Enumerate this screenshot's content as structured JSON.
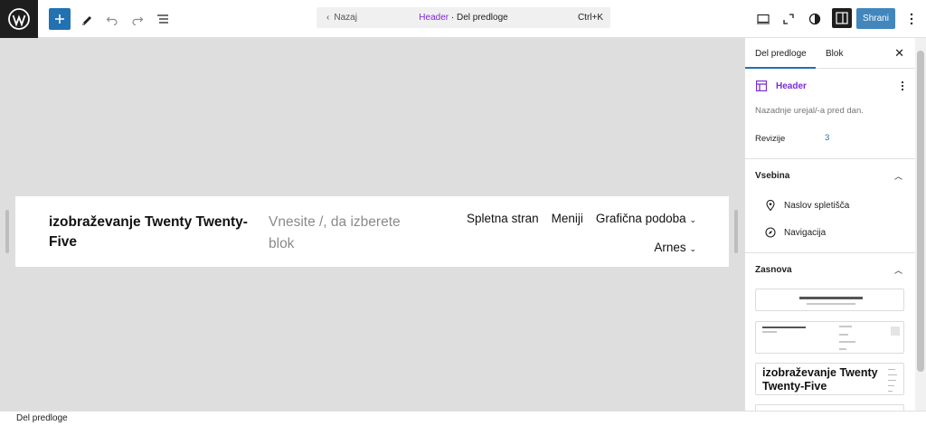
{
  "topbar": {
    "back_label": "Nazaj",
    "doc_title": "Header",
    "doc_type": " · Del predloge",
    "shortcut": "Ctrl+K",
    "save_label": "Shrani"
  },
  "canvas": {
    "site_title": "izobraževanje Twenty Twenty-Five",
    "block_placeholder": "Vnesite /, da izberete blok",
    "nav_row1": [
      "Spletna stran",
      "Meniji",
      "Grafična podoba"
    ],
    "nav_row2": [
      "Arnes"
    ]
  },
  "sidebar": {
    "tab_template_part": "Del predloge",
    "tab_block": "Blok",
    "part_name": "Header",
    "last_edited": "Nazadnje urejal/-a pred dan.",
    "revisions_label": "Revizije",
    "revisions_count": "3",
    "content_title": "Vsebina",
    "content_items": [
      "Naslov spletišča",
      "Navigacija"
    ],
    "layout_title": "Zasnova",
    "pattern_title": "izobraževanje Twenty Twenty-Five"
  },
  "statusbar": {
    "label": "Del predloge"
  },
  "colors": {
    "accent": "#2271b1",
    "template_purple": "#7b2bd9"
  }
}
